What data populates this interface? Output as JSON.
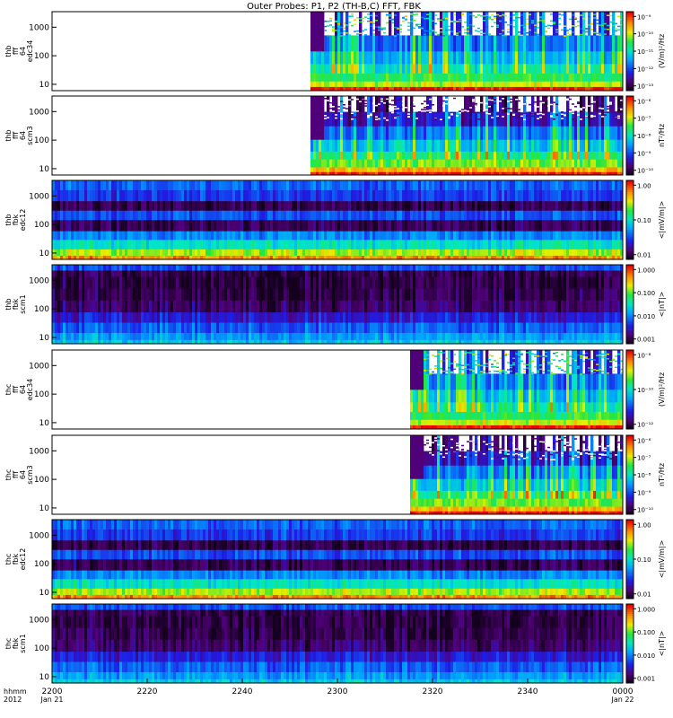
{
  "title": "Outer Probes: P1, P2 (TH-B,C) FFT, FBK",
  "chart_data": {
    "type": "heatmap",
    "x_ticks": [
      "2200",
      "2220",
      "2240",
      "2300",
      "2320",
      "2340",
      "0000"
    ],
    "x_row_labels": [
      "hhmm",
      "2012"
    ],
    "x_date_labels": [
      "Jan 21",
      "Jan 22"
    ],
    "panels": [
      {
        "name": "thb-fff64-edc34",
        "ylabel": [
          "thb",
          "fff",
          "64",
          "edc34"
        ],
        "y_ticks": [
          "10",
          "100",
          "1000"
        ],
        "colorbar_ticks": [
          "10⁻⁹",
          "10⁻¹⁰",
          "10⁻¹¹",
          "10⁻¹²",
          "10⁻¹³"
        ],
        "colorbar_label": "(V/m)²/Hz",
        "data_start": 0.455,
        "style": "fft_e"
      },
      {
        "name": "thb-fff64-scm3",
        "ylabel": [
          "thb",
          "fff",
          "64",
          "scm3"
        ],
        "y_ticks": [
          "10",
          "100",
          "1000"
        ],
        "colorbar_ticks": [
          "10⁻⁶",
          "10⁻⁷",
          "10⁻⁸",
          "10⁻⁹",
          "10⁻¹⁰"
        ],
        "colorbar_label": "nT²/Hz",
        "data_start": 0.455,
        "style": "fft_b"
      },
      {
        "name": "thb-fbk-edc12",
        "ylabel": [
          "thb",
          "fbk",
          "edc12"
        ],
        "y_ticks": [
          "10",
          "100",
          "1000"
        ],
        "colorbar_ticks": [
          "1.00",
          "0.10",
          "0.01"
        ],
        "colorbar_label": "<|mV/m|>",
        "data_start": 0.0,
        "style": "fbk_e"
      },
      {
        "name": "thb-fbk-scm1",
        "ylabel": [
          "thb",
          "fbk",
          "scm1"
        ],
        "y_ticks": [
          "10",
          "100",
          "1000"
        ],
        "colorbar_ticks": [
          "1.000",
          "0.100",
          "0.010",
          "0.001"
        ],
        "colorbar_label": "<|nT|>",
        "data_start": 0.0,
        "style": "fbk_b"
      },
      {
        "name": "thc-fff64-edc34",
        "ylabel": [
          "thc",
          "fff",
          "64",
          "edc34"
        ],
        "y_ticks": [
          "10",
          "100",
          "1000"
        ],
        "colorbar_ticks": [
          "10⁻⁸",
          "10⁻¹⁰",
          "10⁻¹²"
        ],
        "colorbar_label": "(V/m)²/Hz",
        "data_start": 0.63,
        "style": "fft_e"
      },
      {
        "name": "thc-fff64-scm3",
        "ylabel": [
          "thc",
          "fff",
          "64",
          "scm3"
        ],
        "y_ticks": [
          "10",
          "100",
          "1000"
        ],
        "colorbar_ticks": [
          "10⁻⁶",
          "10⁻⁷",
          "10⁻⁸",
          "10⁻⁹",
          "10⁻¹⁰"
        ],
        "colorbar_label": "nT²/Hz",
        "data_start": 0.63,
        "style": "fft_b"
      },
      {
        "name": "thc-fbk-edc12",
        "ylabel": [
          "thc",
          "fbk",
          "edc12"
        ],
        "y_ticks": [
          "10",
          "100",
          "1000"
        ],
        "colorbar_ticks": [
          "1.00",
          "0.10",
          "0.01"
        ],
        "colorbar_label": "<|mV/m|>",
        "data_start": 0.0,
        "style": "fbk_e"
      },
      {
        "name": "thc-fbk-scm1",
        "ylabel": [
          "thc",
          "fbk",
          "scm1"
        ],
        "y_ticks": [
          "10",
          "100",
          "1000"
        ],
        "colorbar_ticks": [
          "1.000",
          "0.100",
          "0.010",
          "0.001"
        ],
        "colorbar_label": "<|nT|>",
        "data_start": 0.0,
        "style": "fbk_b"
      }
    ]
  }
}
